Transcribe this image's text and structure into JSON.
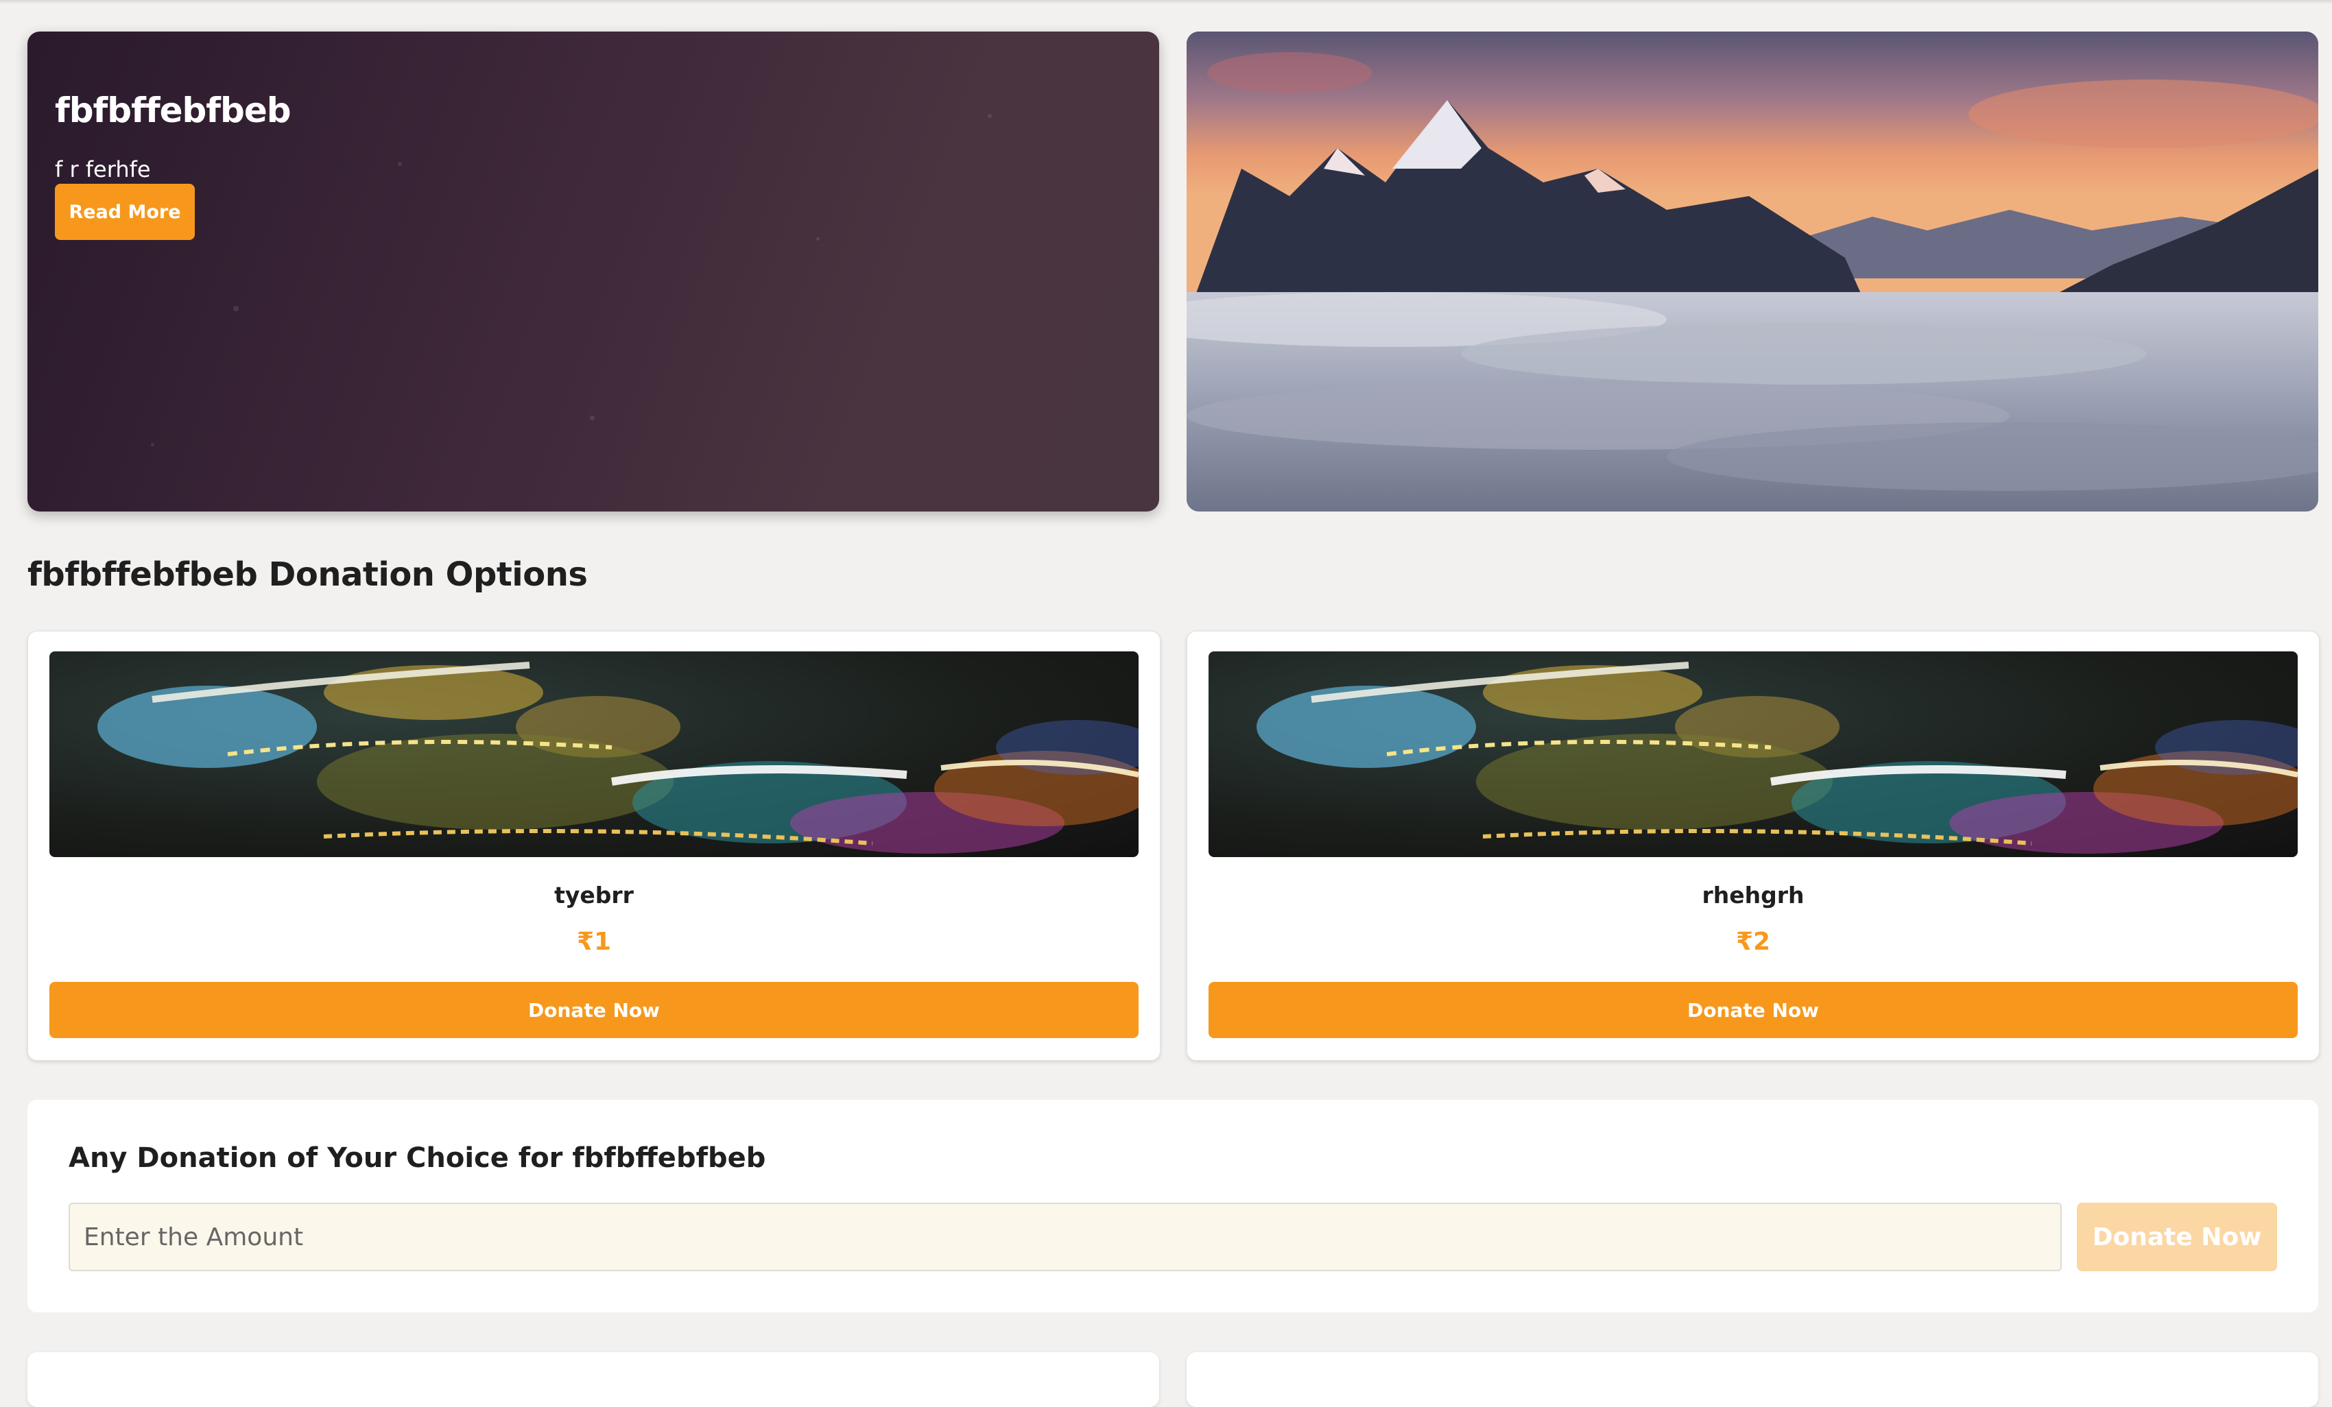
{
  "hero": {
    "title": "fbfbffebfbeb",
    "subtitle": "f r ferhfe",
    "read_more_label": "Read More"
  },
  "donation_options": {
    "heading": "fbfbffebfbeb Donation Options",
    "items": [
      {
        "name": "tyebrr",
        "price": "₹1",
        "button_label": "Donate Now"
      },
      {
        "name": "rhehgrh",
        "price": "₹2",
        "button_label": "Donate Now"
      }
    ]
  },
  "custom_donation": {
    "heading": "Any Donation of Your Choice for fbfbffebfbeb",
    "input_placeholder": "Enter the Amount",
    "input_value": "",
    "button_label": "Donate Now"
  },
  "colors": {
    "accent": "#f7981c",
    "accent_disabled": "#fbd7a4",
    "page_background": "#f2f1ef",
    "input_background": "#fbf7ea"
  }
}
